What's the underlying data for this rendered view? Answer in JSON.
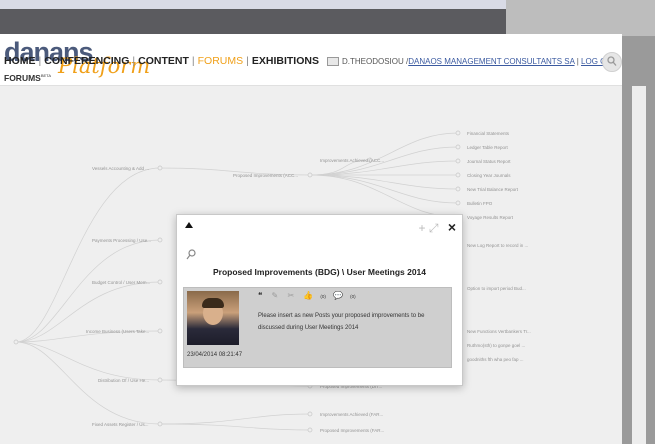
{
  "logo": {
    "top": "danans",
    "bottom": "Platform"
  },
  "nav": {
    "items": [
      "HOME",
      "CONFERENCING",
      "CONTENT",
      "FORUMS",
      "EXHIBITIONS"
    ],
    "separator": "|",
    "active_index": 3,
    "sub_label": "FORUMS",
    "sub_badge": "BETA"
  },
  "user": {
    "name": "D.THEODOSIOU /",
    "company": "DANAOS MANAGEMENT CONSULTANTS SA",
    "sep": " | ",
    "logoff": "LOG OFF"
  },
  "tree": {
    "left_labels": [
      "Vessels Accounting & Add ...",
      "Payments Processing / Use...",
      "Budget Control / User Mem...",
      "Income Business (Users Take...",
      "Distribution Of / Use He...",
      "Fixed Assets Register / Us..."
    ],
    "mid_labels": [
      "Proposed Improvements (ACC...",
      "Improvements Achieved (ACC...",
      "Proposed Improvements (DIT...",
      "Improvements Achieved (FAR...",
      "Proposed Improvements (FAR..."
    ],
    "right_labels": [
      "Financial Statements",
      "Ledger Table Report",
      "Journal Status Report",
      "Closing Year Journals",
      "New Trial Balance Report",
      "Bulletin FPO",
      "Voyage Results Report",
      "New Log Report to record in ...",
      "Option to import period Bud...",
      "New Functions Vertbankers Tr...",
      "Ruthmo(sth) to gonpe goel ...",
      "goodniths fth wha peo fap ..."
    ]
  },
  "modal": {
    "title": "Proposed Improvements (BDG) \\ User Meetings 2014",
    "close": "×",
    "plus": "+",
    "expand": "⤢",
    "post": {
      "date": "23/04/2014 08:21:47",
      "counts": [
        "(0)",
        "(0)"
      ],
      "text": "Please insert as new Posts your proposed improvements to be discussed during User Meetings 2014"
    }
  }
}
